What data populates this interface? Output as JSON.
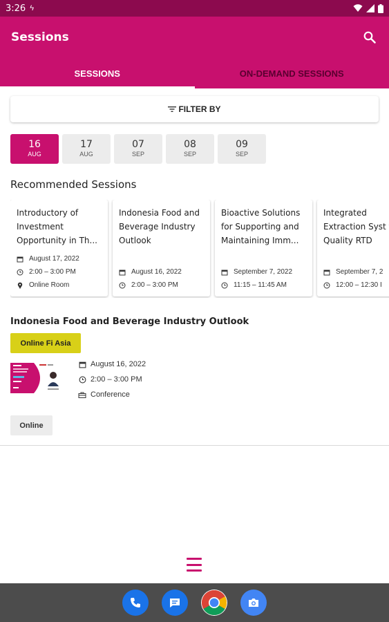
{
  "status_bar": {
    "time": "3:26"
  },
  "app_bar": {
    "title": "Sessions"
  },
  "tabs": [
    {
      "label": "SESSIONS",
      "active": true
    },
    {
      "label": "ON-DEMAND SESSIONS",
      "active": false
    }
  ],
  "filter": {
    "label": "FILTER BY"
  },
  "dates": [
    {
      "day": "16",
      "month": "AUG",
      "selected": true
    },
    {
      "day": "17",
      "month": "AUG",
      "selected": false
    },
    {
      "day": "07",
      "month": "SEP",
      "selected": false
    },
    {
      "day": "08",
      "month": "SEP",
      "selected": false
    },
    {
      "day": "09",
      "month": "SEP",
      "selected": false
    }
  ],
  "recommended": {
    "title": "Recommended Sessions",
    "cards": [
      {
        "title": "Introductory of Investment Opportunity in Th...",
        "date": "August 17, 2022",
        "time": "2:00 – 3:00 PM",
        "location": "Online Room"
      },
      {
        "title": "Indonesia Food and Beverage Industry Outlook",
        "date": "August 16, 2022",
        "time": "2:00 – 3:00 PM"
      },
      {
        "title": "Bioactive Solutions for Supporting and Maintaining Imm...",
        "date": "September 7, 2022",
        "time": "11:15 – 11:45 AM"
      },
      {
        "title": "Integrated Extraction Syst for Quality RTD",
        "date": "September 7, 2",
        "time": "12:00 – 12:30 I"
      }
    ]
  },
  "session": {
    "title": "Indonesia Food and Beverage Industry Outlook",
    "tag": "Online Fi Asia",
    "date": "August 16, 2022",
    "time": "2:00 – 3:00 PM",
    "type": "Conference",
    "chip": "Online"
  },
  "colors": {
    "primary": "#c8106e",
    "status_bar": "#8c0a4e",
    "tag": "#d8d018"
  },
  "dock_apps": [
    "phone-icon",
    "messages-icon",
    "chrome-icon",
    "camera-icon"
  ]
}
